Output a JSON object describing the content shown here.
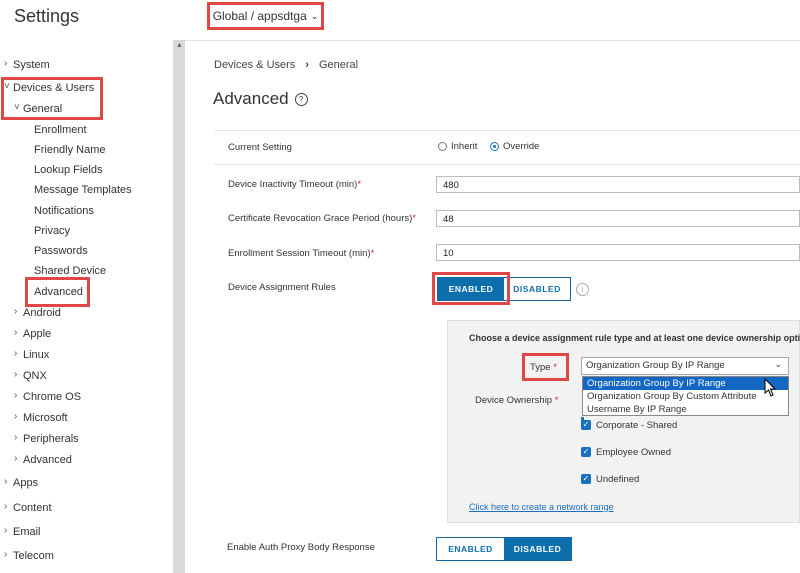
{
  "app": {
    "title": "Settings"
  },
  "org_selector": {
    "label": "Global / appsdtga"
  },
  "sidebar": {
    "system": "System",
    "devices_users": "Devices & Users",
    "general": "General",
    "general_items": [
      "Enrollment",
      "Friendly Name",
      "Lookup Fields",
      "Message Templates",
      "Notifications",
      "Privacy",
      "Passwords",
      "Shared Device",
      "Advanced"
    ],
    "platforms": [
      "Android",
      "Apple",
      "Linux",
      "QNX",
      "Chrome OS",
      "Microsoft",
      "Peripherals",
      "Advanced"
    ],
    "apps": "Apps",
    "content": "Content",
    "email": "Email",
    "telecom": "Telecom"
  },
  "breadcrumb": {
    "parent": "Devices & Users",
    "current": "General"
  },
  "page": {
    "title": "Advanced"
  },
  "form": {
    "current_setting": {
      "label": "Current Setting",
      "option_inherit": "Inherit",
      "option_override": "Override",
      "selected": "Override"
    },
    "inactivity_timeout": {
      "label": "Device Inactivity Timeout (min)",
      "value": "480"
    },
    "cert_grace": {
      "label": "Certificate Revocation Grace Period (hours)",
      "value": "48"
    },
    "enroll_timeout": {
      "label": "Enrollment Session Timeout (min)",
      "value": "10"
    },
    "assignment_rules": {
      "label": "Device Assignment Rules",
      "enabled": "ENABLED",
      "disabled": "DISABLED",
      "selected": "ENABLED"
    },
    "rule_panel": {
      "intro": "Choose a device assignment rule type and at least one device ownership option.",
      "type_label": "Type",
      "type_value": "Organization Group By IP Range",
      "type_options": [
        "Organization Group By IP Range",
        "Organization Group By Custom Attribute",
        "Username By IP Range"
      ],
      "ownership_label": "Device Ownership",
      "ownership_options": [
        "Corporate - Shared",
        "Employee Owned",
        "Undefined"
      ],
      "network_link": "Click here to create a network range"
    },
    "auth_proxy": {
      "label": "Enable Auth Proxy Body Response",
      "enabled": "ENABLED",
      "disabled": "DISABLED",
      "selected": "DISABLED"
    }
  },
  "colors": {
    "accent": "#0d6eac",
    "highlight_box": "#e04848",
    "required": "#c9252c"
  }
}
